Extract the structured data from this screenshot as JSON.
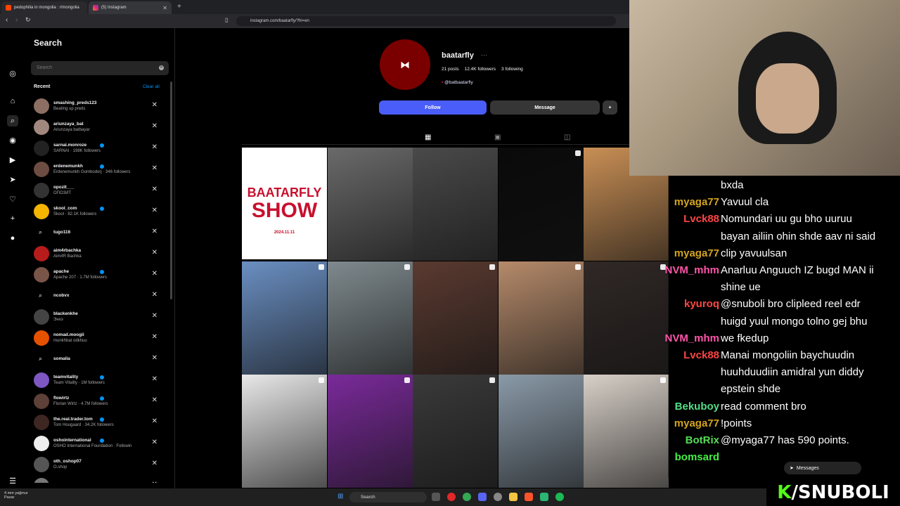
{
  "browser": {
    "tabs": [
      {
        "label": "pedophilia in mongolia : r/mongolia"
      },
      {
        "label": "(5) Instagram"
      }
    ],
    "url": "instagram.com/baatarfly/?hl=en"
  },
  "search_panel": {
    "title": "Search",
    "placeholder": "Search",
    "recent_label": "Recent",
    "clear_all": "Clear all",
    "items": [
      {
        "name": "smashing_preds123",
        "sub": "Beating up preds",
        "color": "#8d6e63"
      },
      {
        "name": "ariunzaya_bat",
        "sub": "Ariunzaya batbayar",
        "color": "#a1887f"
      },
      {
        "name": "sarnai.monroze",
        "sub": "SARNAI · 198K followers",
        "color": "#222222",
        "verified": true
      },
      {
        "name": "erdenemunkh",
        "sub": "Erdenemunkh Gombodorj · 346 followers",
        "color": "#6d4c41",
        "verified": true
      },
      {
        "name": "opozit___",
        "sub": "ОПОЗИТ",
        "color": "#333333"
      },
      {
        "name": "skool_com",
        "sub": "Skool · 82.1K followers",
        "color": "#f4b400",
        "verified": true
      },
      {
        "name": "tugo116",
        "sub": "",
        "search": true
      },
      {
        "name": "aim4rbachka",
        "sub": "Aim4R Bachka",
        "color": "#b71c1c"
      },
      {
        "name": "apache",
        "sub": "Apache 207 · 1.7M followers",
        "color": "#795548",
        "verified": true
      },
      {
        "name": "ncobvx",
        "sub": "",
        "search": true
      },
      {
        "name": "blackenkhe",
        "sub": "Энхэ",
        "color": "#444444"
      },
      {
        "name": "nomad.moogii",
        "sub": "munkhbat odkhuu",
        "color": "#e65100"
      },
      {
        "name": "somalia",
        "sub": "",
        "search": true
      },
      {
        "name": "teamvitality",
        "sub": "Team Vitality · 1M followers",
        "color": "#7e57c2",
        "verified": true
      },
      {
        "name": "flowirtz",
        "sub": "Florian Wirtz · 4.7M followers",
        "color": "#5d4037",
        "verified": true
      },
      {
        "name": "the.real.trader.tom",
        "sub": "Tom Hougaard · 34.2K followers",
        "color": "#3e2723",
        "verified": true
      },
      {
        "name": "oshointernational",
        "sub": "OSHO International Foundation · Followin",
        "color": "#eeeeee",
        "verified": true
      },
      {
        "name": "oth_oshop07",
        "sub": "O.shop",
        "color": "#555555"
      },
      {
        "name": "oshothinkss",
        "sub": "",
        "color": "#777777"
      }
    ]
  },
  "profile": {
    "username": "baatarfly",
    "posts": "21 posts",
    "followers": "12.4K followers",
    "following": "3 following",
    "threads": "@batbaatarfly",
    "follow_btn": "Follow",
    "message_btn": "Message"
  },
  "grid": {
    "show_title": "BAATARFLY",
    "show_sub": "SHOW",
    "show_date": "2024.11.11",
    "cells": [
      "#ffffff",
      "#6a6a6a",
      "#4a4a4a",
      "#0a0a0a",
      "#c98f55",
      "#6a8fc2",
      "#7f8a8e",
      "#5a3a30",
      "#b58a6a",
      "#302826",
      "#e8e8e8",
      "#7a2a9a",
      "#3a3a3a",
      "#8a9aa8",
      "#d8d0c8"
    ]
  },
  "chat": [
    {
      "user": "",
      "msg": "bxda"
    },
    {
      "user": "myaga77",
      "msg": "Yavuul cla",
      "color": "#d4a520"
    },
    {
      "user": "Lvck88",
      "msg": "Nomundari uu gu bho uuruu",
      "color": "#ff4444"
    },
    {
      "user": "",
      "msg": "bayan ailiin ohin shde aav ni said"
    },
    {
      "user": "myaga77",
      "msg": "clip yavuulsan",
      "color": "#d4a520"
    },
    {
      "user": "NVM_mhm",
      "msg": "Anarluu Anguuch IZ bugd MAN ii",
      "color": "#ff55aa"
    },
    {
      "user": "",
      "msg": "shine ue"
    },
    {
      "user": "kyuroq",
      "msg": "@snuboli bro clipleed reel edr",
      "color": "#ff4444"
    },
    {
      "user": "",
      "msg": "huigd yuul mongo tolno gej bhu"
    },
    {
      "user": "NVM_mhm",
      "msg": "we fkedup",
      "color": "#ff55aa"
    },
    {
      "user": "Lvck88",
      "msg": "Manai mongoliin baychuudin",
      "color": "#ff4444"
    },
    {
      "user": "",
      "msg": "huuhduudiin amidral yun diddy"
    },
    {
      "user": "",
      "msg": "epstein shde"
    },
    {
      "user": "Bekuboy",
      "msg": "read comment bro",
      "color": "#55dd88"
    },
    {
      "user": "myaga77",
      "msg": "!points",
      "color": "#d4a520"
    },
    {
      "user": "BotRix",
      "msg": "@myaga77 has 590 points.",
      "color": "#55dd55"
    },
    {
      "user": "bomsard",
      "msg": "",
      "color": "#44ee44"
    }
  ],
  "messages_label": "Messages",
  "taskbar": {
    "search": "Search",
    "weather": "4 mm yağmur",
    "weather_sub": "Pazar"
  },
  "brand": "/SNUBOLI"
}
